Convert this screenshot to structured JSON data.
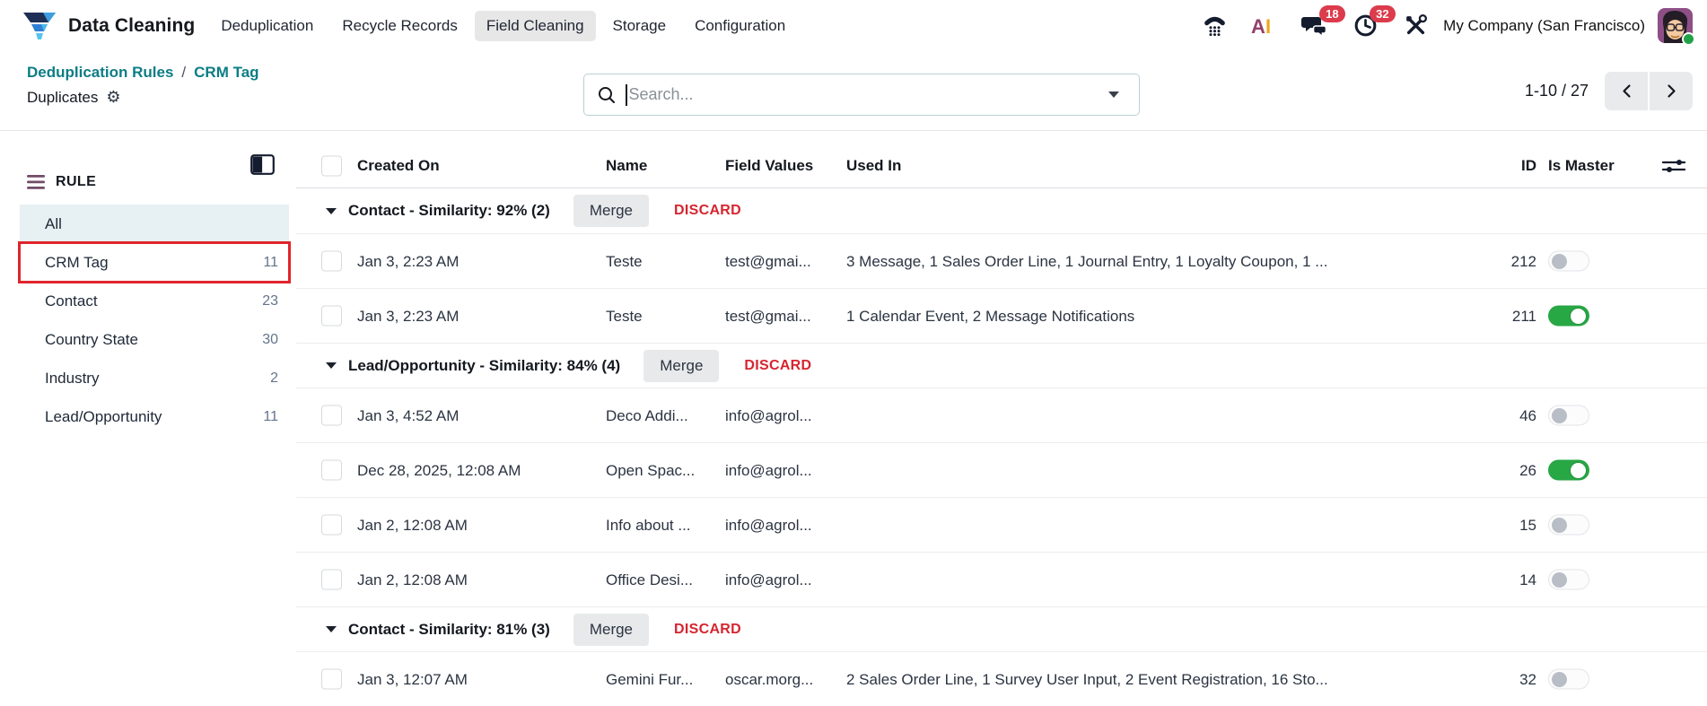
{
  "colors": {
    "teal": "#0c7d85",
    "danger": "#d6252f",
    "success": "#28a745",
    "badge": "#dc3b4c",
    "highlight": "#e0242c"
  },
  "app": {
    "title": "Data Cleaning",
    "nav": [
      {
        "label": "Deduplication",
        "active": false
      },
      {
        "label": "Recycle Records",
        "active": false
      },
      {
        "label": "Field Cleaning",
        "active": true
      },
      {
        "label": "Storage",
        "active": false
      },
      {
        "label": "Configuration",
        "active": false
      }
    ],
    "systray": {
      "icons": [
        "voip-phone-icon",
        "ai-icon",
        "messages-icon",
        "activities-icon",
        "tools-icon"
      ],
      "messages_badge": "18",
      "activities_badge": "32",
      "company": "My Company (San Francisco)"
    }
  },
  "control_panel": {
    "breadcrumb": [
      "Deduplication Rules",
      "CRM Tag"
    ],
    "breadcrumb_separator": "/",
    "title": "Duplicates",
    "search_placeholder": "Search...",
    "pager_range": "1-10 / 27"
  },
  "sidebar": {
    "section_title": "RULE",
    "items": [
      {
        "label": "All",
        "count": "",
        "selected": true,
        "highlighted": false
      },
      {
        "label": "CRM Tag",
        "count": "11",
        "selected": false,
        "highlighted": true
      },
      {
        "label": "Contact",
        "count": "23",
        "selected": false,
        "highlighted": false
      },
      {
        "label": "Country State",
        "count": "30",
        "selected": false,
        "highlighted": false
      },
      {
        "label": "Industry",
        "count": "2",
        "selected": false,
        "highlighted": false
      },
      {
        "label": "Lead/Opportunity",
        "count": "11",
        "selected": false,
        "highlighted": false
      }
    ]
  },
  "table": {
    "columns": [
      "Created On",
      "Name",
      "Field Values",
      "Used In",
      "ID",
      "Is Master"
    ],
    "groups": [
      {
        "label": "Contact - Similarity: 92% (2)",
        "merge_label": "Merge",
        "discard_label": "DISCARD",
        "rows": [
          {
            "created_on": "Jan 3, 2:23 AM",
            "name": "Teste",
            "field_values": "test@gmai...",
            "used_in": "3 Message, 1 Sales Order Line, 1 Journal Entry, 1 Loyalty Coupon, 1 ...",
            "id": "212",
            "is_master": false
          },
          {
            "created_on": "Jan 3, 2:23 AM",
            "name": "Teste",
            "field_values": "test@gmai...",
            "used_in": "1 Calendar Event, 2 Message Notifications",
            "id": "211",
            "is_master": true
          }
        ]
      },
      {
        "label": "Lead/Opportunity - Similarity: 84% (4)",
        "merge_label": "Merge",
        "discard_label": "DISCARD",
        "rows": [
          {
            "created_on": "Jan 3, 4:52 AM",
            "name": "Deco Addi...",
            "field_values": "info@agrol...",
            "used_in": "",
            "id": "46",
            "is_master": false
          },
          {
            "created_on": "Dec 28, 2025, 12:08 AM",
            "name": "Open Spac...",
            "field_values": "info@agrol...",
            "used_in": "",
            "id": "26",
            "is_master": true
          },
          {
            "created_on": "Jan 2, 12:08 AM",
            "name": "Info about ...",
            "field_values": "info@agrol...",
            "used_in": "",
            "id": "15",
            "is_master": false
          },
          {
            "created_on": "Jan 2, 12:08 AM",
            "name": "Office Desi...",
            "field_values": "info@agrol...",
            "used_in": "",
            "id": "14",
            "is_master": false
          }
        ]
      },
      {
        "label": "Contact - Similarity: 81% (3)",
        "merge_label": "Merge",
        "discard_label": "DISCARD",
        "rows": [
          {
            "created_on": "Jan 3, 12:07 AM",
            "name": "Gemini Fur...",
            "field_values": "oscar.morg...",
            "used_in": "2 Sales Order Line, 1 Survey User Input, 2 Event Registration, 16 Sto...",
            "id": "32",
            "is_master": false
          }
        ]
      }
    ]
  }
}
